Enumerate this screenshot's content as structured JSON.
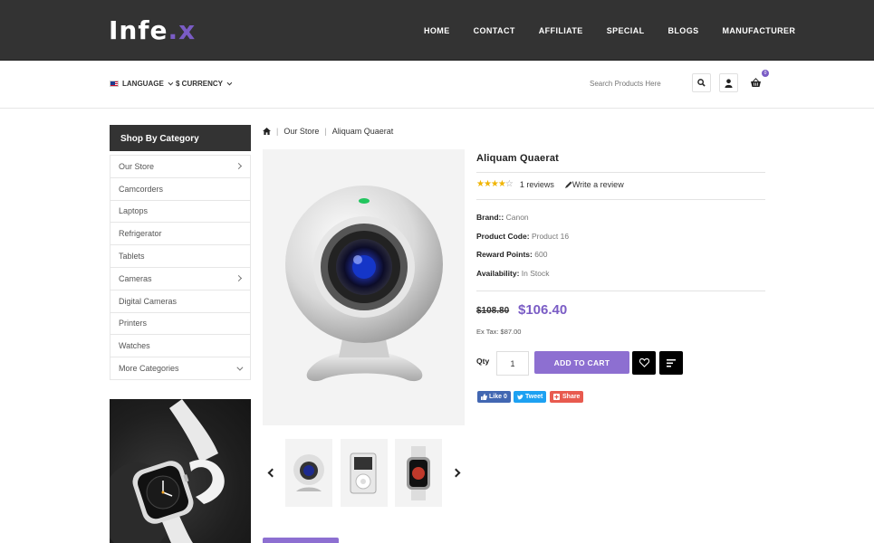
{
  "header": {
    "logo_main": "Infe",
    "logo_dot": ".x",
    "nav": [
      "HOME",
      "CONTACT",
      "AFFILIATE",
      "SPECIAL",
      "BLOGS",
      "MANUFACTURER"
    ]
  },
  "subheader": {
    "language_label": "LANGUAGE",
    "currency_label": "$ CURRENCY",
    "search_placeholder": "Search Products Here",
    "cart_count": "0"
  },
  "sidebar": {
    "title": "Shop By Category",
    "items": [
      {
        "label": "Our Store",
        "expand": "right"
      },
      {
        "label": "Camcorders",
        "expand": ""
      },
      {
        "label": "Laptops",
        "expand": ""
      },
      {
        "label": "Refrigerator",
        "expand": ""
      },
      {
        "label": "Tablets",
        "expand": ""
      },
      {
        "label": "Cameras",
        "expand": "right"
      },
      {
        "label": "Digital Cameras",
        "expand": ""
      },
      {
        "label": "Printers",
        "expand": ""
      },
      {
        "label": "Watches",
        "expand": ""
      },
      {
        "label": "More Categories",
        "expand": "down"
      }
    ]
  },
  "breadcrumb": {
    "items": [
      "Our Store",
      "Aliquam Quaerat"
    ]
  },
  "product": {
    "title": "Aliquam Quaerat",
    "rating": 4,
    "rating_max": 5,
    "reviews_label": "1 reviews",
    "write_review_label": "Write a review",
    "specs": [
      {
        "label": "Brand::",
        "value": "Canon"
      },
      {
        "label": "Product Code:",
        "value": "Product 16"
      },
      {
        "label": "Reward Points:",
        "value": "600"
      },
      {
        "label": "Availability:",
        "value": "In Stock"
      }
    ],
    "old_price": "$108.80",
    "new_price": "$106.40",
    "ex_tax": "Ex Tax: $87.00",
    "qty_label": "Qty",
    "qty_value": "1",
    "add_to_cart_label": "ADD TO CART"
  },
  "share": {
    "like_label": "Like 0",
    "tweet_label": "Tweet",
    "share_label": "Share"
  },
  "colors": {
    "accent": "#8d6fd1",
    "header_bg": "#333333",
    "facebook": "#4267b2",
    "twitter": "#1da1f2",
    "share_red": "#e85a4f"
  }
}
